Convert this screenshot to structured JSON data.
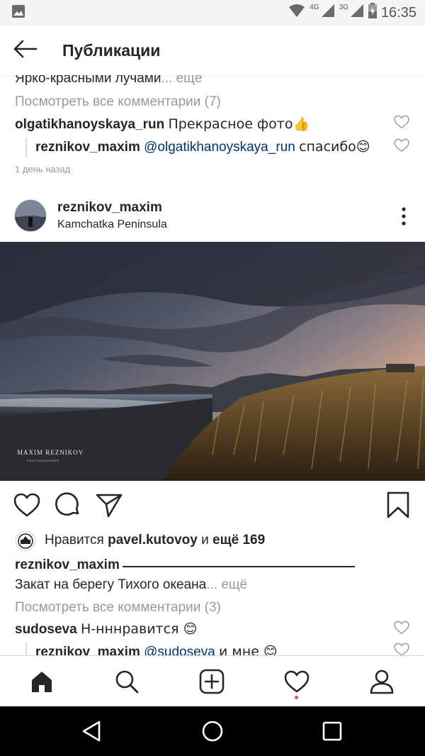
{
  "status_bar": {
    "time": "16:35",
    "network_1": "4G",
    "network_2": "3G",
    "icons": [
      "image-icon",
      "wifi-icon",
      "signal-icon",
      "signal-icon",
      "battery-icon"
    ]
  },
  "header": {
    "title": "Публикации",
    "back_icon": "arrow-left-icon"
  },
  "prev_post": {
    "caption_tail": "Ярко-красными лучами",
    "caption_more": "... ещё",
    "view_comments": "Посмотреть все комментарии (7)",
    "comments": [
      {
        "user": "olgatikhanoyskaya_run",
        "text": "Прекрасное фото👍"
      },
      {
        "user": "reznikov_maxim",
        "mention": "@olgatikhanoyskaya_run",
        "text": "спасибо😊"
      }
    ],
    "time_ago": "1 день назад"
  },
  "post": {
    "username": "reznikov_maxim",
    "location": "Kamchatka Peninsula",
    "watermark_title": "MAXIM REZNIKOV",
    "watermark_sub": "PHOTOGRAPHER",
    "likes_prefix": "Нравится",
    "likes_user": "pavel.kutovoy",
    "likes_and": "и",
    "likes_more": "ещё 169",
    "caption_user": "reznikov_maxim",
    "caption_text": "Закат на берегу Тихого океана",
    "caption_more": "... ещё",
    "view_comments": "Посмотреть все комментарии (3)",
    "comments": [
      {
        "user": "sudoseva",
        "text": "Н-нннравится 😊"
      },
      {
        "user": "reznikov_maxim",
        "mention": "@sudoseva",
        "text": "и мне 😊"
      }
    ]
  },
  "bottom_nav": {
    "items": [
      "home-icon",
      "search-icon",
      "add-post-icon",
      "activity-heart-icon",
      "profile-icon"
    ],
    "active": "home-icon",
    "accent": "#ed4956"
  },
  "system_nav": [
    "back-triangle-icon",
    "home-circle-icon",
    "recents-square-icon"
  ]
}
